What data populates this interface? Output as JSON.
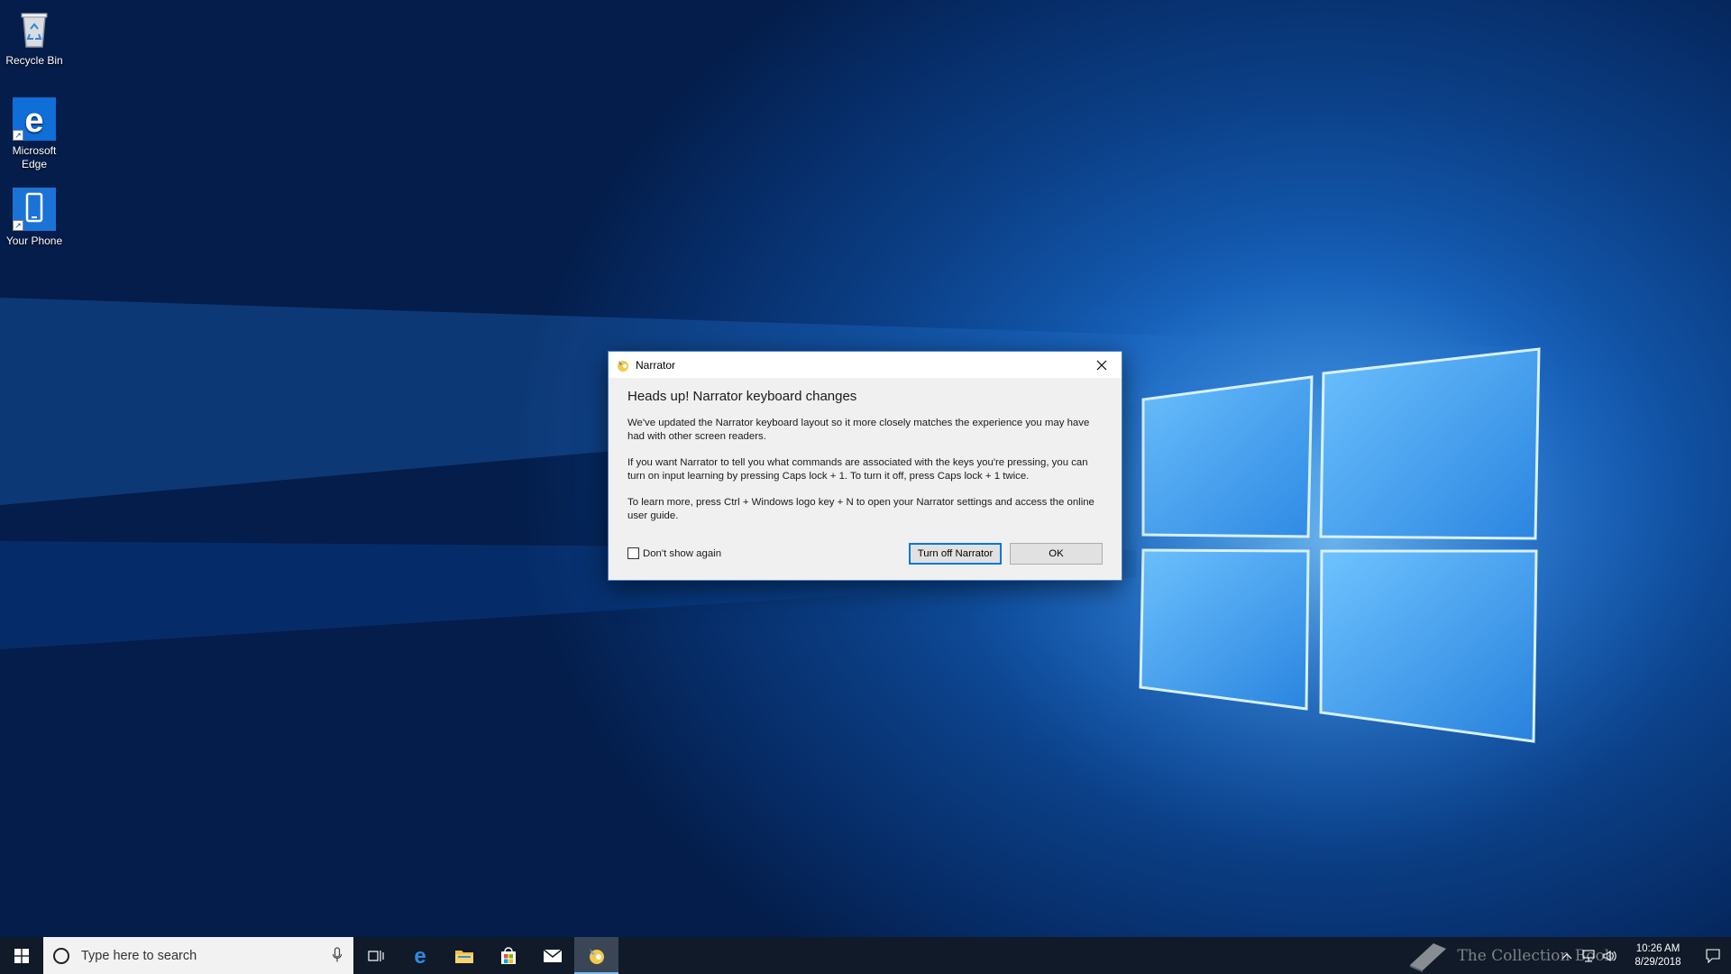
{
  "desktop": {
    "icons": [
      {
        "label": "Recycle Bin",
        "icon": "recycle-bin-icon"
      },
      {
        "label": "Microsoft Edge",
        "icon": "edge-icon"
      },
      {
        "label": "Your Phone",
        "icon": "phone-icon"
      }
    ]
  },
  "dialog": {
    "title": "Narrator",
    "heading": "Heads up! Narrator keyboard changes",
    "paragraphs": [
      "We've updated the Narrator keyboard layout so it more closely matches the experience you may have had with other screen readers.",
      "If you want Narrator to tell you what commands are associated with the keys you're pressing, you can turn on input learning by pressing Caps lock + 1. To turn it off, press Caps lock + 1 twice.",
      "To learn more, press Ctrl + Windows logo key + N to open your Narrator settings and access the online user guide."
    ],
    "checkbox_label": "Don't show again",
    "checkbox_checked": false,
    "turn_off_label": "Turn off Narrator",
    "ok_label": "OK"
  },
  "taskbar": {
    "search_placeholder": "Type here to search",
    "pinned": [
      "task-view-icon",
      "edge-icon",
      "file-explorer-icon",
      "store-icon",
      "mail-icon",
      "narrator-icon"
    ],
    "active_app": "narrator-icon",
    "clock_time": "10:26 AM",
    "clock_date": "8/29/2018",
    "watermark": "The Collection Book"
  },
  "colors": {
    "accent": "#0078d7",
    "taskbar": "#101a28",
    "dialog_bg": "#f0f0f0"
  }
}
